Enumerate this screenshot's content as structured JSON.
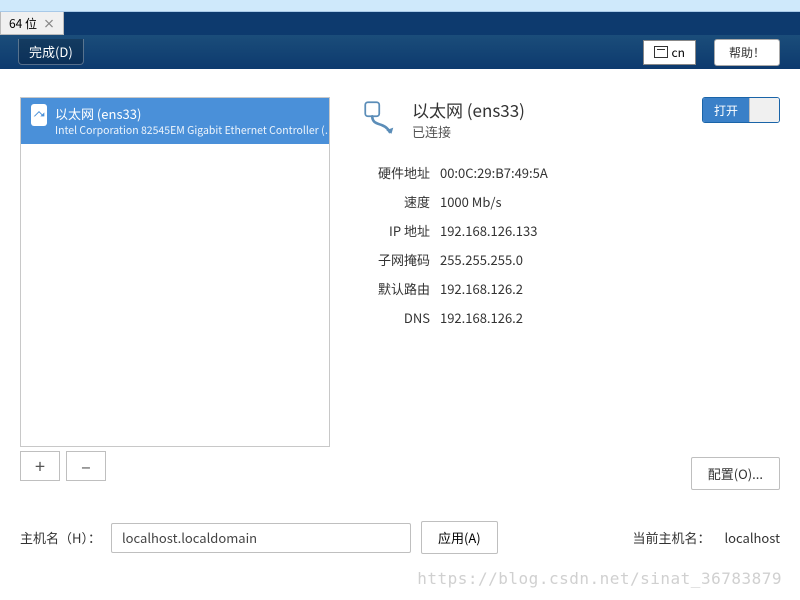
{
  "tab": {
    "label": "64 位",
    "close": "×"
  },
  "topbar": {
    "done": "完成(D)",
    "input_method": "cn",
    "help": "帮助！"
  },
  "sidebar": {
    "item": {
      "title": "以太网 (ens33)",
      "subtitle": "Intel Corporation 82545EM Gigabit Ethernet Controller (…"
    },
    "add": "+",
    "remove": "–"
  },
  "detail": {
    "title": "以太网 (ens33)",
    "status": "已连接",
    "toggle_label": "打开",
    "props": [
      {
        "label": "硬件地址",
        "value": "00:0C:29:B7:49:5A"
      },
      {
        "label": "速度",
        "value": "1000 Mb/s"
      },
      {
        "label": "IP 地址",
        "value": "192.168.126.133"
      },
      {
        "label": "子网掩码",
        "value": "255.255.255.0"
      },
      {
        "label": "默认路由",
        "value": "192.168.126.2"
      },
      {
        "label": "DNS",
        "value": "192.168.126.2"
      }
    ],
    "configure": "配置(O)..."
  },
  "host": {
    "label": "主机名（H）：",
    "value": "localhost.localdomain",
    "apply": "应用(A)",
    "current_label": "当前主机名：",
    "current_value": "localhost"
  },
  "watermark": "https://blog.csdn.net/sinat_36783879"
}
